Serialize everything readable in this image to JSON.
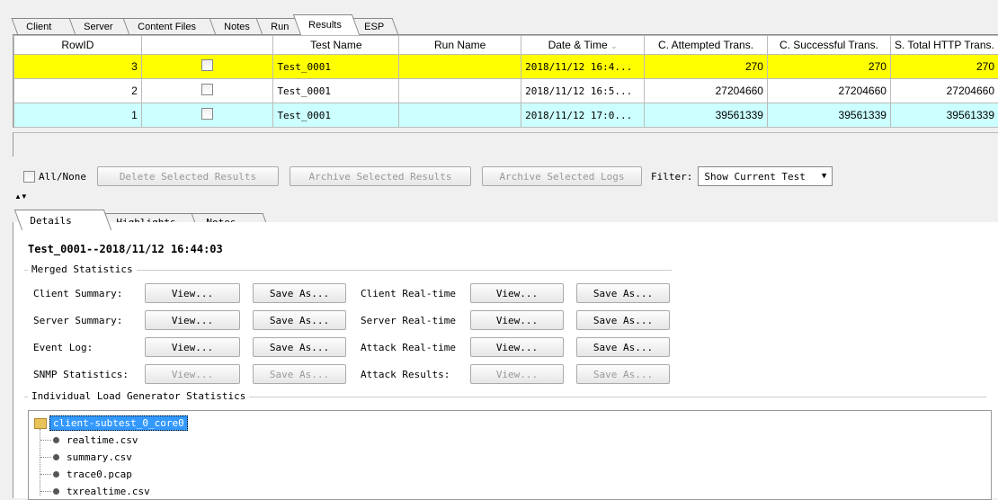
{
  "top_tabs": [
    "Client",
    "Server",
    "Content Files",
    "Notes",
    "Run",
    "Results",
    "ESP"
  ],
  "results_table": {
    "columns": [
      "RowID",
      "",
      "Test Name",
      "Run Name",
      "Date & Time",
      "C. Attempted Trans.",
      "C. Successful Trans.",
      "S. Total HTTP Trans."
    ],
    "rows": [
      {
        "rowid": "3",
        "test_name": "Test_0001",
        "run_name": "",
        "datetime": "2018/11/12 16:4...",
        "attempted": "270",
        "successful": "270",
        "total_http": "270"
      },
      {
        "rowid": "2",
        "test_name": "Test_0001",
        "run_name": "",
        "datetime": "2018/11/12 16:5...",
        "attempted": "27204660",
        "successful": "27204660",
        "total_http": "27204660"
      },
      {
        "rowid": "1",
        "test_name": "Test_0001",
        "run_name": "",
        "datetime": "2018/11/12 17:0...",
        "attempted": "39561339",
        "successful": "39561339",
        "total_http": "39561339"
      }
    ]
  },
  "actions": {
    "all_none": "All/None",
    "delete_selected": "Delete Selected Results",
    "archive_results": "Archive Selected Results",
    "archive_logs": "Archive Selected Logs",
    "filter_label": "Filter:",
    "filter_value": "Show Current Test"
  },
  "bottom_tabs": [
    "Details",
    "Highlights",
    "Notes"
  ],
  "details": {
    "heading": "Test_0001--2018/11/12 16:44:03",
    "merged_title": "Merged Statistics",
    "view": "View...",
    "save_as": "Save As...",
    "rows": [
      {
        "left": "Client Summary:",
        "right": "Client Real-time"
      },
      {
        "left": "Server Summary:",
        "right": "Server Real-time"
      },
      {
        "left": "Event Log:",
        "right": "Attack Real-time"
      },
      {
        "left": "SNMP Statistics:",
        "right": "Attack Results:"
      }
    ],
    "individual_title": "Individual Load Generator Statistics",
    "tree": {
      "folder": "client-subtest_0_core0",
      "files": [
        "realtime.csv",
        "summary.csv",
        "trace0.pcap",
        "txrealtime.csv"
      ]
    }
  },
  "colors": {
    "highlight_row": "#ffff00",
    "alt_row": "#ccffff",
    "selection": "#3399ff"
  }
}
